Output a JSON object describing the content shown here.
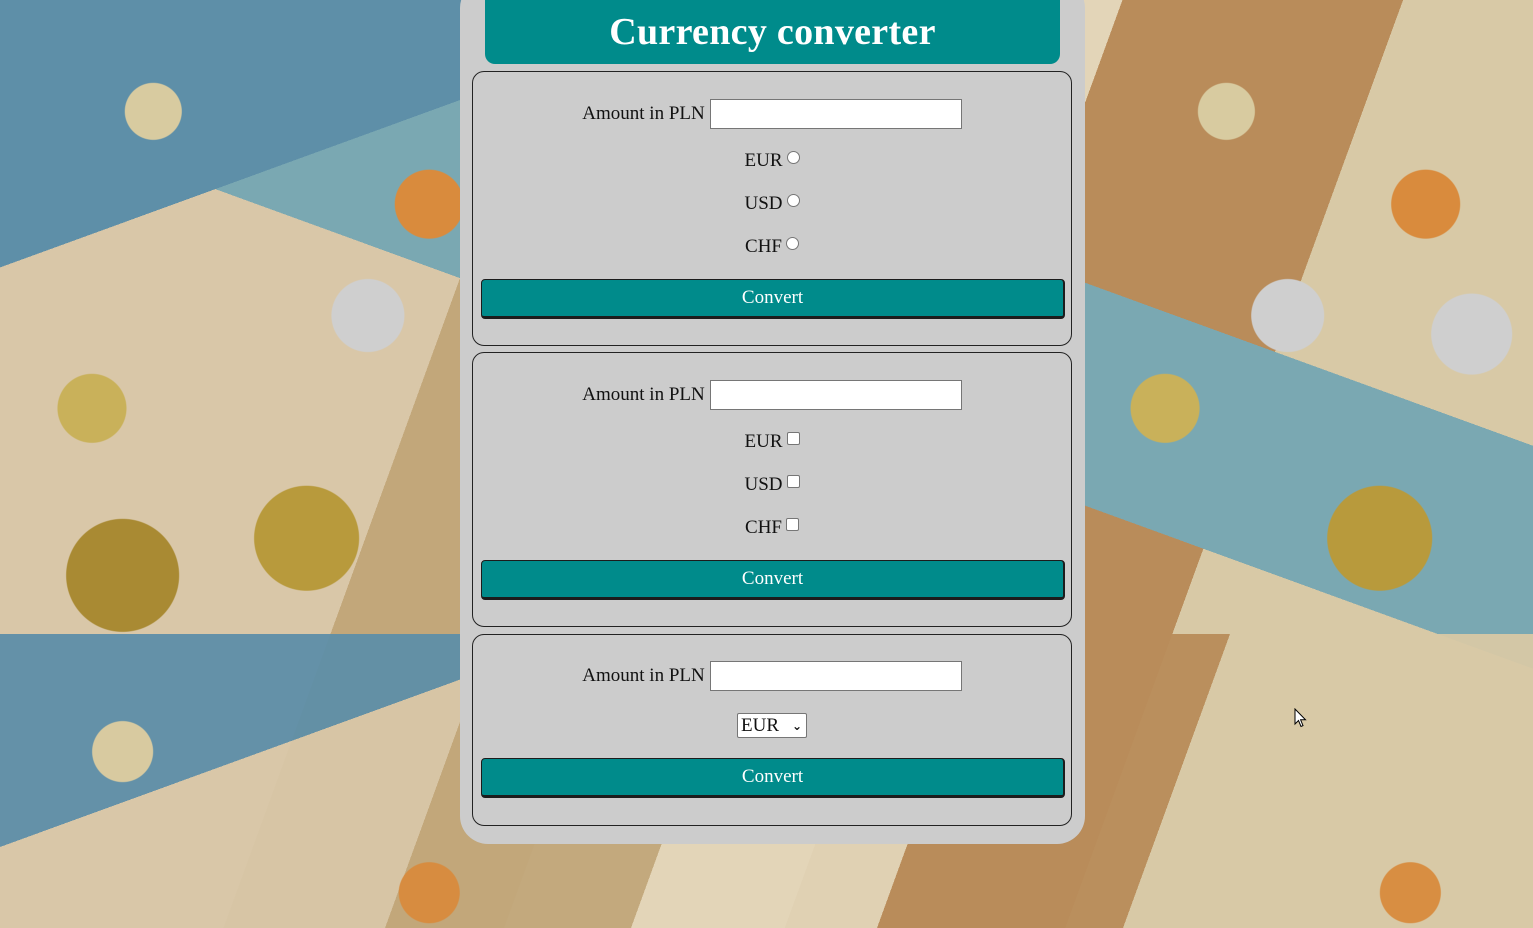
{
  "header": {
    "title": "Currency converter"
  },
  "forms": [
    {
      "amount_label": "Amount in PLN",
      "amount_value": "",
      "input_type": "radio",
      "options": [
        "EUR",
        "USD",
        "CHF"
      ],
      "button_label": "Convert"
    },
    {
      "amount_label": "Amount in PLN",
      "amount_value": "",
      "input_type": "checkbox",
      "options": [
        "EUR",
        "USD",
        "CHF"
      ],
      "button_label": "Convert"
    },
    {
      "amount_label": "Amount in PLN",
      "amount_value": "",
      "input_type": "select",
      "selected_option": "EUR",
      "button_label": "Convert"
    }
  ],
  "colors": {
    "accent": "#008b8b",
    "panel": "#cccccc"
  },
  "icons": {
    "select_arrow": "chevron-down-icon",
    "cursor": "mouse-pointer-icon"
  }
}
